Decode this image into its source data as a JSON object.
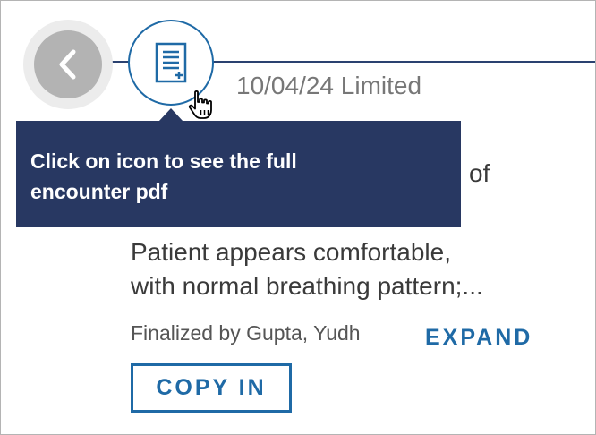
{
  "timeline": {
    "back_icon": "chevron-left-icon",
    "document_icon": "document-plus-icon",
    "cursor_icon": "hand-pointer-icon"
  },
  "encounter": {
    "title": "10/04/24 Limited",
    "note_peek": "of",
    "note_lines": [
      "Patient appears comfortable,",
      "with normal breathing pattern;..."
    ],
    "finalized_by": "Finalized by Gupta, Yudh",
    "expand_label": "EXPAND",
    "copy_label": "COPY IN"
  },
  "tooltip": {
    "lines": [
      "Click on icon to see the full",
      "encounter pdf"
    ]
  },
  "colors": {
    "accent": "#1f6aa6",
    "tooltip_bg": "#283862",
    "timeline": "#2a4170",
    "back_button": "#b3b3b3"
  }
}
